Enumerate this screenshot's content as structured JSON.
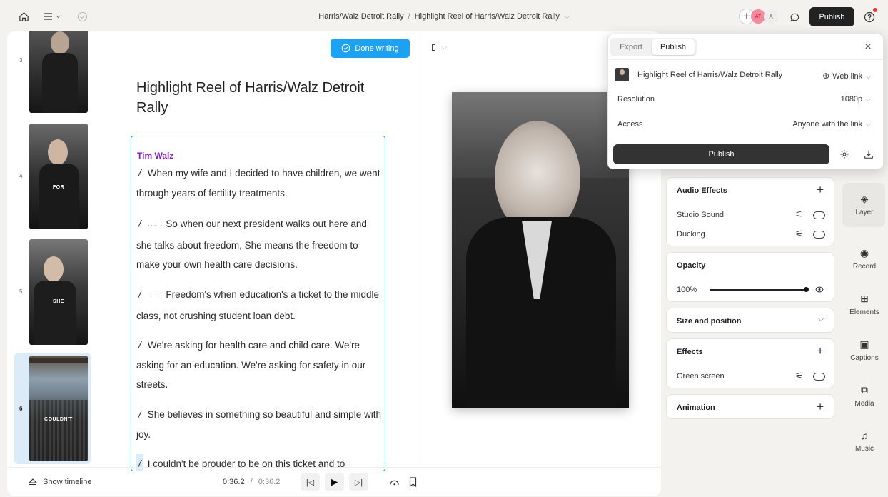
{
  "topbar": {
    "breadcrumb_project": "Harris/Walz Detroit Rally",
    "breadcrumb_sep": "/",
    "breadcrumb_doc": "Highlight Reel of Harris/Walz Detroit Rally",
    "avatar_initials_1": "AT",
    "avatar_initials_2": "A",
    "publish_label": "Publish"
  },
  "thumbnails": [
    {
      "num": "3",
      "word": ""
    },
    {
      "num": "4",
      "word": "FOR"
    },
    {
      "num": "5",
      "word": "SHE"
    },
    {
      "num": "6",
      "word": "COULDN'T"
    }
  ],
  "editor": {
    "done_writing_label": "Done writing",
    "title": "Highlight Reel of Harris/Walz Detroit Rally",
    "speaker": "Tim Walz",
    "paragraphs": [
      "When my wife and I decided to have children, we went through years of fertility treatments.",
      "So when our next president walks out here and she talks about freedom, She means the freedom to make your own health care decisions.",
      "Freedom's when education's a ticket to the middle class, not crushing student loan debt.",
      "We're asking for health care and child care. We're asking for an education. We're asking for safety in our streets.",
      "She believes in something so beautiful and simple with joy.",
      "I couldn't be prouder to be on this ticket and to"
    ]
  },
  "player": {
    "show_timeline_label": "Show timeline",
    "current_time": "0:36.2",
    "time_sep": "/",
    "total_time": "0:36.2"
  },
  "popover": {
    "tab_export": "Export",
    "tab_publish": "Publish",
    "file_name": "Highlight Reel of Harris/Walz Detroit Rally",
    "link_type": "Web link",
    "resolution_label": "Resolution",
    "resolution_value": "1080p",
    "access_label": "Access",
    "access_value": "Anyone with the link",
    "publish_label": "Publish"
  },
  "panels": {
    "audio_effects": "Audio Effects",
    "studio_sound": "Studio Sound",
    "ducking": "Ducking",
    "opacity": "Opacity",
    "opacity_value": "100%",
    "size_position": "Size and position",
    "effects": "Effects",
    "green_screen": "Green screen",
    "animation": "Animation"
  },
  "rail": {
    "layer": "Layer",
    "record": "Record",
    "elements": "Elements",
    "captions": "Captions",
    "media": "Media",
    "music": "Music"
  },
  "colors": {
    "accent_blue": "#1da1f2",
    "speaker_purple": "#7a1fbf",
    "dark_button": "#222222"
  }
}
